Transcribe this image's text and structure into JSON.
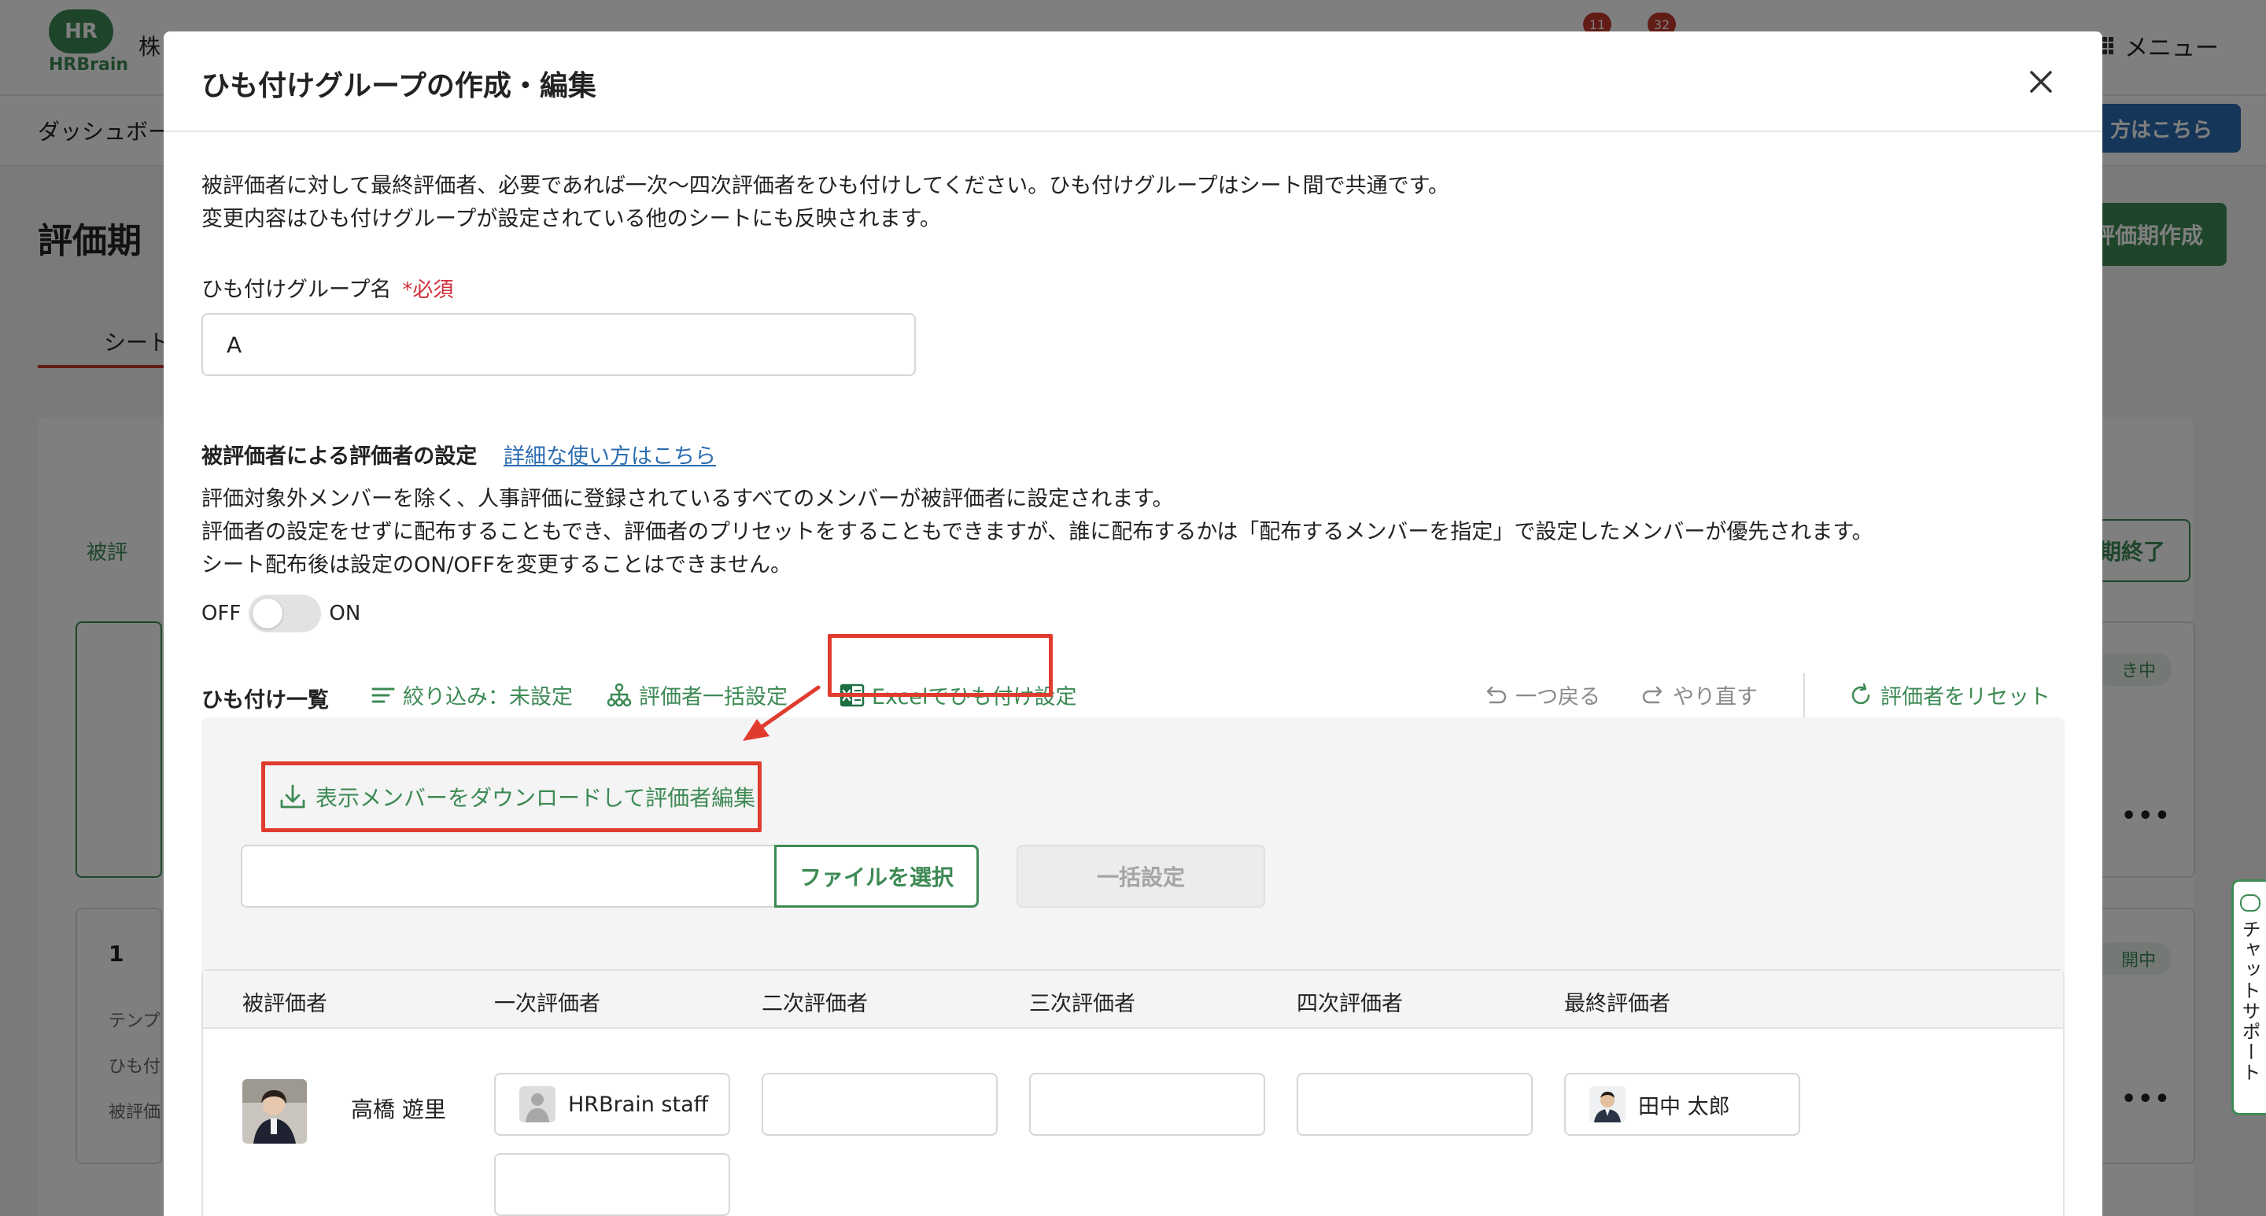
{
  "background": {
    "logo": "HR",
    "logo_text": "HRBrain",
    "company": "株",
    "menu": "メニュー",
    "badges": [
      "11",
      "32"
    ],
    "nav_item": "ダッシュボー",
    "help_button": "方はこちら",
    "page_title": "評価期",
    "create_button": "評価期作成",
    "tab": "シート",
    "side_label": "被評",
    "end_button": "期終了",
    "status_pill_1": "き中",
    "status_pill_2": "開中",
    "card_lines": [
      "テンプ",
      "ひも付",
      "被評価"
    ],
    "card_number": "1",
    "more": "•••"
  },
  "chat_support": "チャットサポート",
  "modal": {
    "title": "ひも付けグループの作成・編集",
    "description_lines": [
      "被評価者に対して最終評価者、必要であれば一次〜四次評価者をひも付けしてください。ひも付けグループはシート間で共通です。",
      "変更内容はひも付けグループが設定されている他のシートにも反映されます。"
    ],
    "group_name_label": "ひも付けグループ名",
    "required_mark": "*必須",
    "group_name_value": "A",
    "evaluee_setting_title": "被評価者による評価者の設定",
    "help_link": "詳細な使い方はこちら",
    "setting_desc_lines": [
      "評価対象外メンバーを除く、人事評価に登録されているすべてのメンバーが被評価者に設定されます。",
      "評価者の設定をせずに配布することもでき、評価者のプリセットをすることもできますが、誰に配布するかは「配布するメンバーを指定」で設定したメンバーが優先されます。",
      "シート配布後は設定のON/OFFを変更することはできません。"
    ],
    "toggle_off": "OFF",
    "toggle_on": "ON",
    "toolbar": {
      "label": "ひも付け一覧",
      "filter": "絞り込み：未設定",
      "bulk_evaluator": "評価者一括設定",
      "excel": "Excelでひも付け設定",
      "undo": "一つ戻る",
      "redo": "やり直す",
      "reset": "評価者をリセット"
    },
    "excel_panel": {
      "download": "表示メンバーをダウンロードして評価者編集",
      "select_file": "ファイルを選択",
      "bulk_apply": "一括設定"
    },
    "table": {
      "headers": [
        "被評価者",
        "一次評価者",
        "二次評価者",
        "三次評価者",
        "四次評価者",
        "最終評価者"
      ],
      "rows": [
        {
          "evaluee": "高橋 遊里",
          "first": "HRBrain staff",
          "final": "田中 太郎"
        }
      ]
    }
  }
}
